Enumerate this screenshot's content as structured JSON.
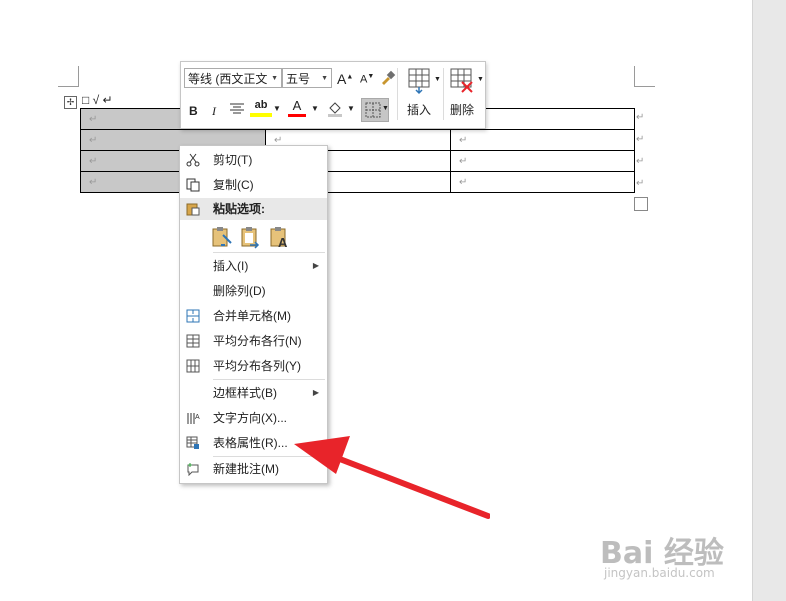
{
  "doc": {
    "move_symbol": "✢",
    "checkbox_text": "□ √ ↵",
    "return_mark": "↵",
    "table": {
      "rows": [
        [
          "↵",
          "",
          "↵"
        ],
        [
          "↵",
          "↵",
          "↵"
        ],
        [
          "↵",
          "↵",
          "↵"
        ],
        [
          "↵",
          "↵",
          "↵"
        ]
      ]
    }
  },
  "mini_toolbar": {
    "font_name": "等线 (西文正文",
    "font_size": "五号",
    "grow_font": "A",
    "shrink_font": "A",
    "bold": "B",
    "italic": "I",
    "highlight_text": "ab",
    "font_color_text": "A",
    "insert_label": "插入",
    "delete_label": "删除",
    "highlight_color": "#ffff00",
    "font_color": "#ff0000"
  },
  "context_menu": {
    "items": [
      {
        "label": "剪切(T)",
        "icon": "scissors-icon"
      },
      {
        "label": "复制(C)",
        "icon": "copy-icon"
      },
      {
        "label": "粘贴选项:",
        "icon": "clipboard-icon"
      },
      {
        "label": "插入(I)",
        "submenu": true
      },
      {
        "label": "删除列(D)"
      },
      {
        "label": "合并单元格(M)",
        "icon": "merge-cells-icon"
      },
      {
        "label": "平均分布各行(N)",
        "icon": "distribute-rows-icon"
      },
      {
        "label": "平均分布各列(Y)",
        "icon": "distribute-columns-icon"
      },
      {
        "label": "边框样式(B)",
        "submenu": true
      },
      {
        "label": "文字方向(X)...",
        "icon": "text-direction-icon"
      },
      {
        "label": "表格属性(R)...",
        "icon": "table-properties-icon"
      },
      {
        "label": "新建批注(M)",
        "icon": "new-comment-icon"
      }
    ],
    "submenu_arrow": "▶"
  },
  "watermark": {
    "brand": "Bai 经验",
    "url": "jingyan.baidu.com"
  },
  "colors": {
    "arrow": "#e8242a",
    "selection": "#c8c8c8"
  }
}
